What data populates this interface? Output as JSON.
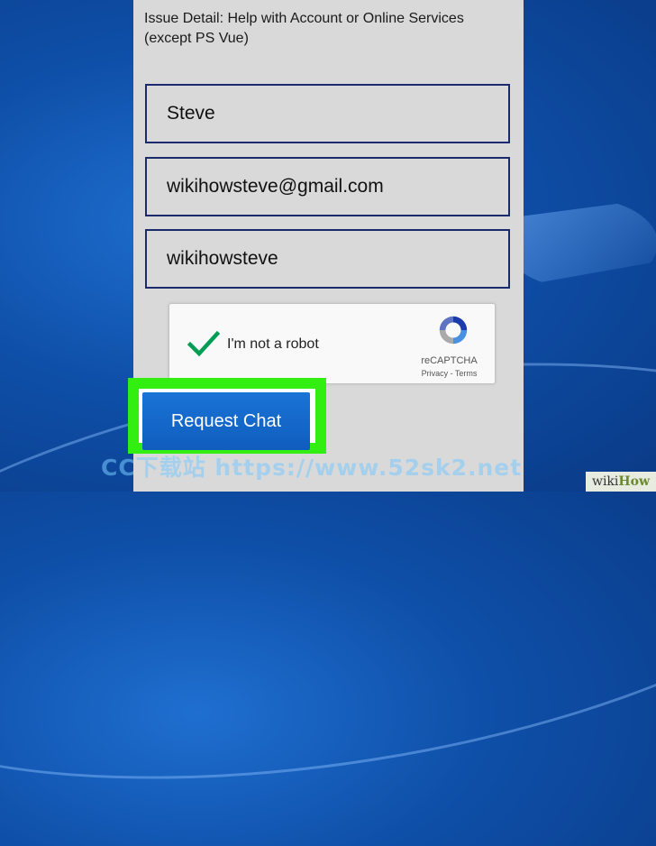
{
  "issue_detail": "Issue Detail: Help with Account or Online Services (except PS Vue)",
  "form": {
    "name_value": "Steve",
    "email_value": "wikihowsteve@gmail.com",
    "online_id_value": "wikihowsteve"
  },
  "captcha": {
    "label": "I'm not a robot",
    "checked": true,
    "brand": "reCAPTCHA",
    "links": "Privacy - Terms"
  },
  "request_chat_label": "Request Chat",
  "watermark": "CC下载站 https://www.52sk2.net",
  "wikihow_logo": {
    "prefix": "wiki",
    "suffix": "How"
  },
  "colors": {
    "highlight": "#33ee11",
    "button": "#1468cc",
    "field_border": "#1a2a6c",
    "check": "#009e55"
  }
}
